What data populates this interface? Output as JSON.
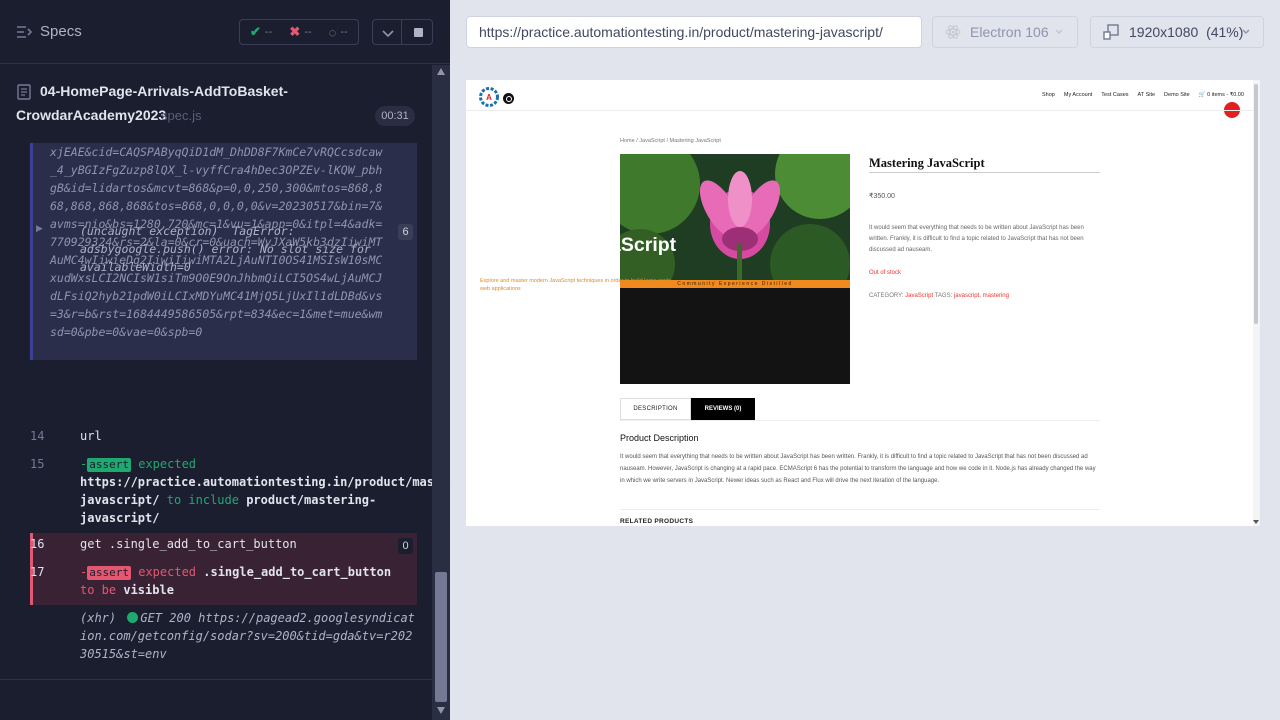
{
  "runner": {
    "title": "Specs",
    "stats": {
      "passed": "--",
      "failed": "--",
      "pending": "--"
    },
    "spec": {
      "name_line1": "04-HomePage-Arrivals-AddToBasket-",
      "name_line2": "CrowdarAcademy2023",
      "ext": "spec.js",
      "duration": "00:31"
    },
    "log": {
      "xhr_block_text": "xjEAE&cid=CAQSPAByqQiD1dM_DhDD8F7KmCe7vRQCcsdcaw_4_yBGIzFgZuzp8lQX_l-vyffCra4hDec3OPZEv-lKQW_pbhgB&id=lidartos&mcvt=868&p=0,0,250,300&mtos=868,868,868,868,868&tos=868,0,0,0,0&v=20230517&bin=7&avms=nio&bs=1280,720&mc=1&vu=1&app=0&itpl=4&adk=770929324&rs=2&la=0&cr=0&uach=WyJXaW5kb3dzIiwiMTAuMC4wIiwieDg2IiwiIiwiMTA2LjAuNTI0OS41MSIsW10sMCxudWxsLCI2NCIsW1siTm9O0E9OnJhbmQiLCI5OS4wLjAuMCJdLFsiQ2hyb21pdW0iLCIxMDYuMC41MjQ5LjUxIl1dLDBd&vs=3&r=b&rst=1684449586505&rpt=834&ec=1&met=mue&wmsd=0&pbe=0&vae=0&spb=0",
      "exception_text": "(uncaught exception)  TagError: adsbygoogle.push() error: No slot size for availableWidth=0",
      "exception_count": "6",
      "line14_num": "14",
      "line14_text": "url",
      "line15_num": "15",
      "line15_badge": "assert",
      "line15_expected": "expected",
      "line15_url": "https://practice.automationtesting.in/product/mastering-javascript/",
      "line15_include": "to include",
      "line15_sub": "product/mastering-javascript/",
      "line16_num": "16",
      "line16_text": "get  .single_add_to_cart_button",
      "line16_count": "0",
      "line17_num": "17",
      "line17_badge": "assert",
      "line17_expected": "expected",
      "line17_selector": ".single_add_to_cart_button",
      "line17_tobe": "to be",
      "line17_visible": "visible",
      "xhr2_prefix": "(xhr)",
      "xhr2_status": "GET 200",
      "xhr2_url": "https://pagead2.googlesyndication.com/getconfig/sodar?sv=200&tid=gda&tv=r20230515&st=env"
    }
  },
  "topbar": {
    "url": "https://practice.automationtesting.in/product/mastering-javascript/",
    "browser": "Electron 106",
    "viewport": "1920x1080  (41%)"
  },
  "site": {
    "nav": [
      "Shop",
      "My Account",
      "Test Cases",
      "AT Site",
      "Demo Site",
      "🛒 0 items - ₹0.00"
    ],
    "breadcrumb": "Home / JavaScript / Mastering JavaScript",
    "cover_band": "Community Experience Distilled",
    "cover_title": "Mastering JavaScript",
    "cover_sub": "Explore and master modern JavaScript techniques in order to build large-scale web applications",
    "product_title": "Mastering JavaScript",
    "price": "₹350.00",
    "description": "It would seem that everything that needs to be written about JavaScript has been written. Frankly, it is difficult to find a topic related to JavaScript that has not been discussed ad nauseam.",
    "stock": "Out of stock",
    "meta_category_label": "CATEGORY:",
    "meta_category": "JavaScript",
    "meta_tags_label": "TAGS:",
    "meta_tags": "javascript, mastering",
    "tab_description": "DESCRIPTION",
    "tab_reviews": "REVIEWS (0)",
    "pd_title": "Product Description",
    "pd_text": "It would seem that everything that needs to be written about JavaScript has been written. Frankly, it is difficult to find a topic related to JavaScript that has not been discussed ad nauseam. However, JavaScript is changing at a rapid pace. ECMAScript 6 has the potential to transform the language and how we code in it. Node.js has already changed the way in which we write servers in JavaScript. Newer ideas such as React and Flux will drive the next iteration of the language.",
    "related": "RELATED PRODUCTS"
  },
  "colors": {
    "pass": "#1fa971",
    "fail": "#e45770",
    "panel": "#1b1e2e",
    "cart_badge": "#e32020"
  }
}
